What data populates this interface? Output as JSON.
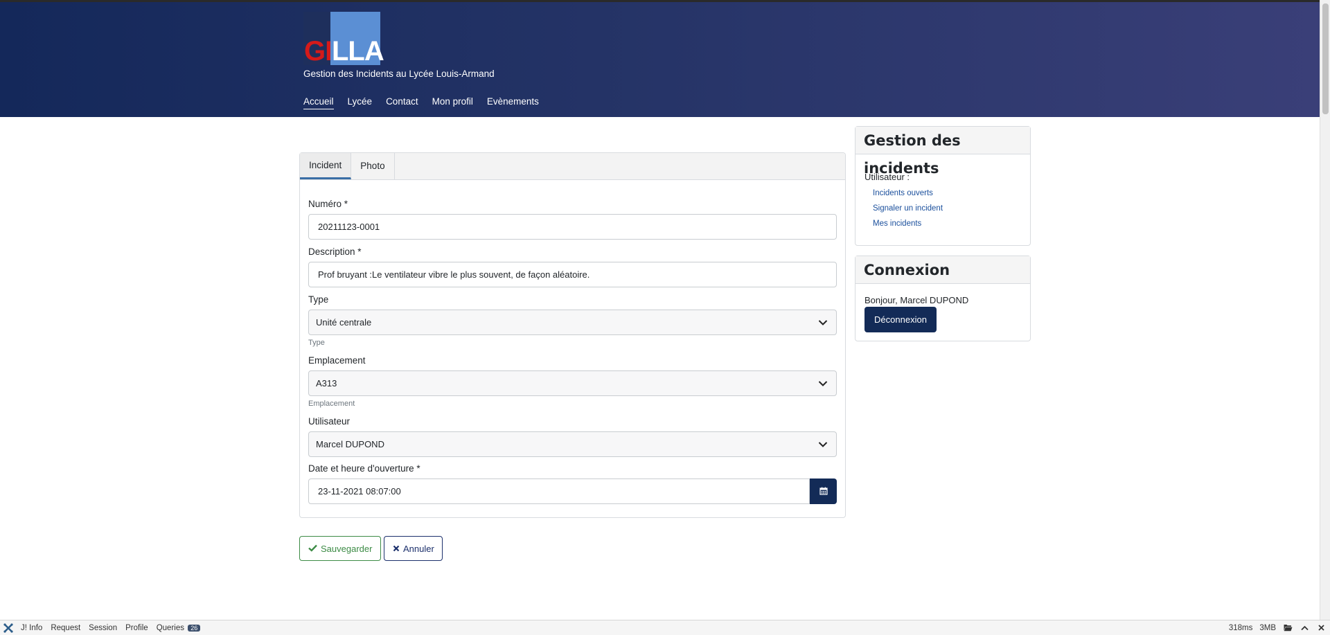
{
  "header": {
    "logo_left": "GI",
    "logo_right": "LLA",
    "tagline": "Gestion des Incidents au Lycée Louis-Armand",
    "nav": [
      "Accueil",
      "Lycée",
      "Contact",
      "Mon profil",
      "Evènements"
    ]
  },
  "form": {
    "tabs": [
      "Incident",
      "Photo"
    ],
    "numero_label": "Numéro *",
    "numero_value": "20211123-0001",
    "description_label": "Description *",
    "description_value": "Prof bruyant :Le ventilateur vibre le plus souvent, de façon aléatoire.",
    "type_label": "Type",
    "type_value": "Unité centrale",
    "type_hint": "Type",
    "emplacement_label": "Emplacement",
    "emplacement_value": "A313",
    "emplacement_hint": "Emplacement",
    "utilisateur_label": "Utilisateur",
    "utilisateur_value": "Marcel DUPOND",
    "date_label": "Date et heure d'ouverture *",
    "date_value": "23-11-2021 08:07:00"
  },
  "actions": {
    "save_label": "Sauvegarder",
    "cancel_label": "Annuler"
  },
  "sidebar": {
    "incidents_title": "Gestion des incidents",
    "user_label": "Utilisateur :",
    "links": [
      "Incidents ouverts",
      "Signaler un incident",
      "Mes incidents"
    ],
    "login_title": "Connexion",
    "greeting": "Bonjour, Marcel DUPOND",
    "logout_label": "Déconnexion"
  },
  "debugbar": {
    "items": [
      "J! Info",
      "Request",
      "Session",
      "Profile",
      "Queries"
    ],
    "queries_count": "26",
    "time": "318ms",
    "memory": "3MB"
  },
  "colors": {
    "header_start": "#14285a",
    "header_end": "#3a3f78",
    "primary": "#132b57",
    "success": "#3c8b45",
    "link": "#1a4f9c"
  }
}
